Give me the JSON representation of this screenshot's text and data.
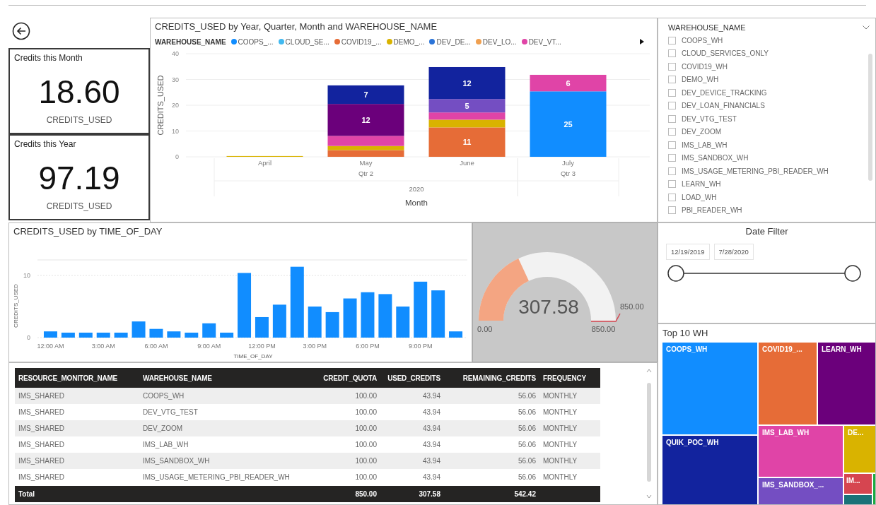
{
  "kpis": [
    {
      "title": "Credits this Month",
      "value": "18.60",
      "label": "CREDITS_USED"
    },
    {
      "title": "Credits this Year",
      "value": "97.19",
      "label": "CREDITS_USED"
    }
  ],
  "warehouse_chart": {
    "title": "CREDITS_USED by Year, Quarter, Month and WAREHOUSE_NAME",
    "legend_title": "WAREHOUSE_NAME",
    "quarters": [
      {
        "label": "Qtr 2"
      },
      {
        "label": "Qtr 3"
      }
    ],
    "year": "2020",
    "chart_data": {
      "type": "bar",
      "stacked": true,
      "grid": true,
      "xlabel": "Month",
      "ylabel": "CREDITS_USED",
      "categories": [
        "April",
        "May",
        "June",
        "July"
      ],
      "ylim": [
        0,
        40
      ],
      "yticks": [
        0,
        10,
        20,
        30,
        40
      ],
      "series": [
        {
          "name": "COOPS_...",
          "color": "#118dff",
          "values": [
            null,
            null,
            null,
            25.4
          ]
        },
        {
          "name": "CLOUD_SE...",
          "color": "#41b9f0",
          "values": [
            null,
            null,
            null,
            null
          ]
        },
        {
          "name": "COVID19_...",
          "color": "#e66c37",
          "values": [
            null,
            2.6,
            11.4,
            null
          ]
        },
        {
          "name": "DEMO_...",
          "color": "#d9b300",
          "values": [
            0.3,
            1.6,
            3.0,
            null
          ]
        },
        {
          "name": "DEV_DE...",
          "color": "#2b74d8",
          "values": [
            null,
            null,
            null,
            null
          ]
        },
        {
          "name": "DEV_LO...",
          "color": "#f0a050",
          "values": [
            null,
            null,
            null,
            null
          ]
        },
        {
          "name": "DEV_VT...",
          "color": "#e044a7",
          "values": [
            null,
            3.9,
            2.8,
            6.4
          ]
        },
        {
          "color": "#744ec2",
          "values": [
            null,
            null,
            5.2,
            null
          ]
        },
        {
          "color": "#6b007b",
          "values": [
            null,
            12.4,
            null,
            null
          ]
        },
        {
          "color": "#12239e",
          "values": [
            null,
            7.2,
            12.4,
            null
          ]
        }
      ],
      "value_labels": [
        [
          null,
          null,
          null,
          "25"
        ],
        [
          null,
          null,
          null,
          null
        ],
        [
          null,
          null,
          "11",
          null
        ],
        [
          null,
          null,
          null,
          null
        ],
        [
          null,
          null,
          null,
          null
        ],
        [
          null,
          null,
          null,
          null
        ],
        [
          null,
          null,
          null,
          "6"
        ],
        [
          null,
          null,
          "5",
          null
        ],
        [
          null,
          "12",
          null,
          null
        ],
        [
          null,
          "7",
          "12",
          null
        ]
      ]
    }
  },
  "slicer": {
    "title": "WAREHOUSE_NAME",
    "items": [
      {
        "label": "COOPS_WH",
        "checked": false
      },
      {
        "label": "CLOUD_SERVICES_ONLY",
        "checked": false
      },
      {
        "label": "COVID19_WH",
        "checked": false
      },
      {
        "label": "DEMO_WH",
        "checked": false
      },
      {
        "label": "DEV_DEVICE_TRACKING",
        "checked": false
      },
      {
        "label": "DEV_LOAN_FINANCIALS",
        "checked": false
      },
      {
        "label": "DEV_VTG_TEST",
        "checked": false
      },
      {
        "label": "DEV_ZOOM",
        "checked": false
      },
      {
        "label": "IMS_LAB_WH",
        "checked": false
      },
      {
        "label": "IMS_SANDBOX_WH",
        "checked": false
      },
      {
        "label": "IMS_USAGE_METERING_PBI_READER_WH",
        "checked": false
      },
      {
        "label": "LEARN_WH",
        "checked": false
      },
      {
        "label": "LOAD_WH",
        "checked": false
      },
      {
        "label": "PBI_READER_WH",
        "checked": false
      }
    ]
  },
  "time_chart": {
    "title": "CREDITS_USED by TIME_OF_DAY",
    "chart_data": {
      "type": "bar",
      "grid": true,
      "xlabel": "TIME_OF_DAY",
      "ylabel": "CREDITS_USED",
      "x": [
        0,
        1,
        2,
        3,
        4,
        5,
        6,
        7,
        8,
        9,
        10,
        11,
        12,
        13,
        14,
        15,
        16,
        17,
        18,
        19,
        20,
        21,
        22,
        23
      ],
      "values": [
        1.0,
        0.8,
        0.8,
        0.8,
        0.8,
        2.6,
        1.4,
        1.0,
        0.8,
        2.3,
        0.8,
        10.4,
        3.3,
        5.3,
        11.4,
        5.0,
        4.1,
        6.3,
        7.3,
        7.0,
        5.0,
        9.0,
        7.6,
        1.0
      ],
      "xlim": [
        -0.5,
        23.5
      ],
      "xticks": [
        {
          "value": 0,
          "label": "12:00 AM"
        },
        {
          "value": 3,
          "label": "3:00 AM"
        },
        {
          "value": 6,
          "label": "6:00 AM"
        },
        {
          "value": 9,
          "label": "9:00 AM"
        },
        {
          "value": 12,
          "label": "12:00 PM"
        },
        {
          "value": 15,
          "label": "3:00 PM"
        },
        {
          "value": 18,
          "label": "6:00 PM"
        },
        {
          "value": 21,
          "label": "9:00 PM"
        }
      ],
      "ylim": [
        0,
        12.5
      ],
      "yticks": [
        0,
        10
      ]
    }
  },
  "gauge": {
    "value": "307.58",
    "min": "0.00",
    "max": "850.00",
    "target": "850.00"
  },
  "date_filter": {
    "title": "Date Filter",
    "start": "12/19/2019",
    "end": "7/28/2020"
  },
  "table": {
    "columns": [
      "RESOURCE_MONITOR_NAME",
      "WAREHOUSE_NAME",
      "CREDIT_QUOTA",
      "USED_CREDITS",
      "REMAINING_CREDITS",
      "FREQUENCY"
    ],
    "rows": [
      [
        "IMS_SHARED",
        "COOPS_WH",
        "100.00",
        "43.94",
        "56.06",
        "MONTHLY"
      ],
      [
        "IMS_SHARED",
        "DEV_VTG_TEST",
        "100.00",
        "43.94",
        "56.06",
        "MONTHLY"
      ],
      [
        "IMS_SHARED",
        "DEV_ZOOM",
        "100.00",
        "43.94",
        "56.06",
        "MONTHLY"
      ],
      [
        "IMS_SHARED",
        "IMS_LAB_WH",
        "100.00",
        "43.94",
        "56.06",
        "MONTHLY"
      ],
      [
        "IMS_SHARED",
        "IMS_SANDBOX_WH",
        "100.00",
        "43.94",
        "56.06",
        "MONTHLY"
      ],
      [
        "IMS_SHARED",
        "IMS_USAGE_METERING_PBI_READER_WH",
        "100.00",
        "43.94",
        "56.06",
        "MONTHLY"
      ]
    ],
    "total": {
      "label": "Total",
      "credit_quota": "850.00",
      "used_credits": "307.58",
      "remaining_credits": "542.42"
    }
  },
  "treemap": {
    "title": "Top 10 WH",
    "tiles": [
      {
        "label": "COOPS_WH",
        "color": "#118dff"
      },
      {
        "label": "QUIK_POC_WH",
        "color": "#12239e"
      },
      {
        "label": "COVID19_...",
        "color": "#e66c37"
      },
      {
        "label": "LEARN_WH",
        "color": "#6b007b"
      },
      {
        "label": "IMS_LAB_WH",
        "color": "#e044a7"
      },
      {
        "label": "IMS_SANDBOX_...",
        "color": "#744ec2"
      },
      {
        "label": "DE...",
        "color": "#d9b300"
      },
      {
        "label": "IM...",
        "color": "#d64550"
      },
      {
        "color": "#197278"
      },
      {
        "color": "#1aab40"
      }
    ]
  }
}
